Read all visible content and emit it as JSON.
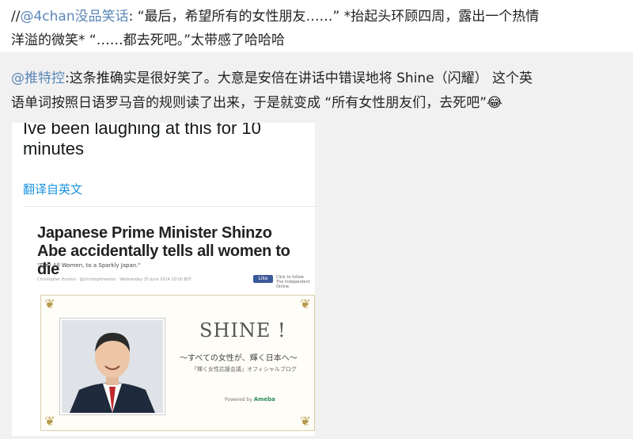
{
  "post": {
    "repost_prefix": "//",
    "original_author": "@4chan没品笑话",
    "original_text": ": “最后，希望所有的女性朋友……” *抬起头环顾四周，露出一个热情",
    "original_text_line2": "洋溢的微笑* “……都去死吧。”太带感了哈哈哈"
  },
  "reply": {
    "author": "@推特控",
    "text_line1": ":这条推确实是很好笑了。大意是安倍在讲话中错误地将 Shine（闪耀） 这个英",
    "text_line2": "语单词按照日语罗马音的规则读了出来，于是就变成 “所有女性朋友们，去死吧”",
    "emoji": "😂"
  },
  "tweet": {
    "text": "Ive been laughing at this for 10 minutes",
    "translate_label": "翻译自英文"
  },
  "article": {
    "headline": "Japanese Prime Minister Shinzo Abe accidentally tells all women to die",
    "quote": "\"Die! All Women, to a Sparkly Japan.\"",
    "byline": "Christopher Hooton · @christophhooton · Wednesday 25 June 2014 10:00 BST",
    "fb_like": "Like",
    "fb_note": "Click to follow The Independent Online",
    "blog_title": "SHINE !",
    "blog_subtitle": "〜すべての女性が、輝く日本へ〜",
    "blog_sub2": "「輝く女性応援会議」オフィシャルブログ",
    "powered_label": "Powered by",
    "powered_brand": "Ameba"
  },
  "colors": {
    "mention": "#5b86b7",
    "link": "#1b95e0",
    "background": "#f1f1f1"
  }
}
